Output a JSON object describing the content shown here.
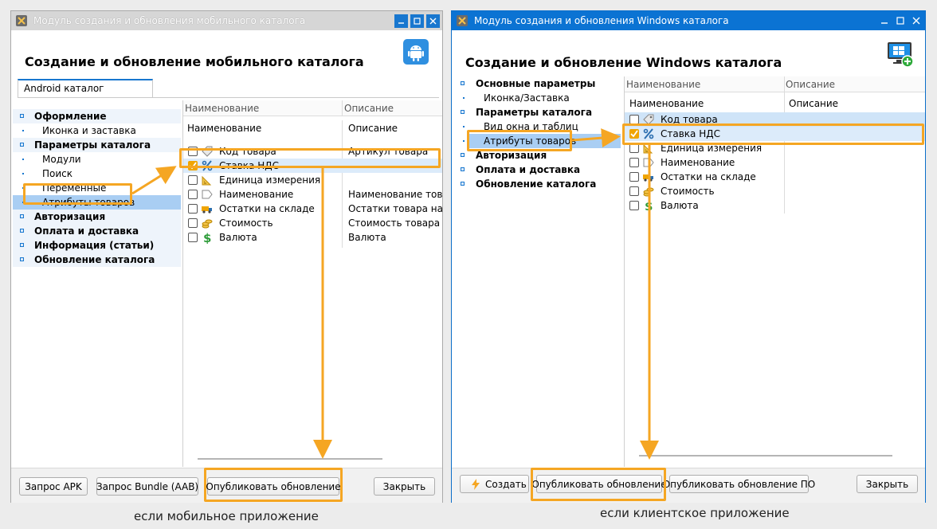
{
  "left": {
    "window_title": "Модуль создания и обновления мобильного каталога",
    "header_title": "Создание и обновление мобильного каталога",
    "tab_label": "Android каталог",
    "sidebar": [
      {
        "label": "Оформление",
        "kind": "group"
      },
      {
        "label": "Иконка и заставка",
        "kind": "child"
      },
      {
        "label": "Параметры каталога",
        "kind": "group"
      },
      {
        "label": "Модули",
        "kind": "child"
      },
      {
        "label": "Поиск",
        "kind": "child"
      },
      {
        "label": "Переменные",
        "kind": "child"
      },
      {
        "label": "Атрибуты товаров",
        "kind": "child-selected"
      },
      {
        "label": "Авторизация",
        "kind": "group"
      },
      {
        "label": "Оплата и доставка",
        "kind": "group"
      },
      {
        "label": "Информация (статьи)",
        "kind": "group"
      },
      {
        "label": "Обновление каталога",
        "kind": "group"
      }
    ],
    "grid_header_top": {
      "name": "Наименование",
      "desc": "Описание"
    },
    "grid_header": {
      "name": "Наименование",
      "desc": "Описание"
    },
    "rows": [
      {
        "name": "Код товара",
        "desc": "Артикул товара",
        "icon": "tag-icon",
        "checked": false
      },
      {
        "name": "Ставка НДС",
        "desc": "",
        "icon": "percent-icon",
        "checked": true
      },
      {
        "name": "Единица измерения",
        "desc": "",
        "icon": "ruler-icon",
        "checked": false
      },
      {
        "name": "Наименование",
        "desc": "Наименование товара",
        "icon": "label-icon",
        "checked": false
      },
      {
        "name": "Остатки на складе",
        "desc": "Остатки товара на складе",
        "icon": "truck-icon",
        "checked": false
      },
      {
        "name": "Стоимость",
        "desc": "Стоимость товара",
        "icon": "coins-icon",
        "checked": false
      },
      {
        "name": "Валюта",
        "desc": "Валюта",
        "icon": "dollar-icon",
        "checked": false
      }
    ],
    "buttons": {
      "apk": "Запрос APK",
      "aab": "Запрос Bundle (AAB)",
      "publish": "Опубликовать обновление",
      "close": "Закрыть"
    },
    "caption": "если мобильное приложение"
  },
  "right": {
    "window_title": "Модуль создания и обновления Windows каталога",
    "header_title": "Создание и обновление Windows каталога",
    "sidebar": [
      {
        "label": "Основные параметры",
        "kind": "group"
      },
      {
        "label": "Иконка/Заставка",
        "kind": "child"
      },
      {
        "label": "Параметры каталога",
        "kind": "group"
      },
      {
        "label": "Вид окна и таблиц",
        "kind": "child"
      },
      {
        "label": "Атрибуты товаров",
        "kind": "child-selected"
      },
      {
        "label": "Авторизация",
        "kind": "group"
      },
      {
        "label": "Оплата и доставка",
        "kind": "group"
      },
      {
        "label": "Обновление каталога",
        "kind": "group"
      }
    ],
    "grid_header_top": {
      "name": "Наименование",
      "desc": "Описание"
    },
    "grid_header": {
      "name": "Наименование",
      "desc": "Описание"
    },
    "rows": [
      {
        "name": "Код товара",
        "desc": "",
        "icon": "tag-icon",
        "checked": false
      },
      {
        "name": "Ставка НДС",
        "desc": "",
        "icon": "percent-icon",
        "checked": true
      },
      {
        "name": "Единица измерения",
        "desc": "",
        "icon": "ruler-icon",
        "checked": false
      },
      {
        "name": "Наименование",
        "desc": "",
        "icon": "label-icon",
        "checked": false
      },
      {
        "name": "Остатки на складе",
        "desc": "",
        "icon": "truck-icon",
        "checked": false
      },
      {
        "name": "Стоимость",
        "desc": "",
        "icon": "coins-icon",
        "checked": false
      },
      {
        "name": "Валюта",
        "desc": "",
        "icon": "dollar-icon",
        "checked": false
      }
    ],
    "buttons": {
      "create": "Создать",
      "publish": "Опубликовать обновление",
      "publish_po": "Опубликовать обновление ПО",
      "close": "Закрыть"
    },
    "caption": "если клиентское приложение"
  },
  "colors": {
    "highlight": "#f5a623",
    "selection": "#a9cef3",
    "accent": "#1877cf"
  }
}
